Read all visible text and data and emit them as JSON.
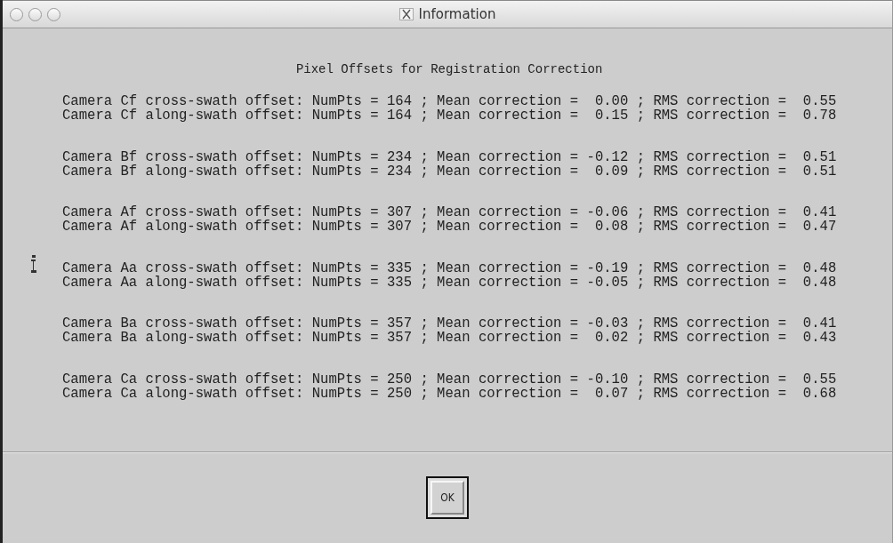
{
  "window": {
    "title": "Information"
  },
  "heading": "Pixel Offsets for Registration Correction",
  "groups": [
    {
      "lines": [
        "Camera Cf cross-swath offset: NumPts = 164 ; Mean correction =  0.00 ; RMS correction =  0.55",
        "Camera Cf along-swath offset: NumPts = 164 ; Mean correction =  0.15 ; RMS correction =  0.78"
      ]
    },
    {
      "lines": [
        "Camera Bf cross-swath offset: NumPts = 234 ; Mean correction = -0.12 ; RMS correction =  0.51",
        "Camera Bf along-swath offset: NumPts = 234 ; Mean correction =  0.09 ; RMS correction =  0.51"
      ]
    },
    {
      "lines": [
        "Camera Af cross-swath offset: NumPts = 307 ; Mean correction = -0.06 ; RMS correction =  0.41",
        "Camera Af along-swath offset: NumPts = 307 ; Mean correction =  0.08 ; RMS correction =  0.47"
      ]
    },
    {
      "lines": [
        "Camera Aa cross-swath offset: NumPts = 335 ; Mean correction = -0.19 ; RMS correction =  0.48",
        "Camera Aa along-swath offset: NumPts = 335 ; Mean correction = -0.05 ; RMS correction =  0.48"
      ]
    },
    {
      "lines": [
        "Camera Ba cross-swath offset: NumPts = 357 ; Mean correction = -0.03 ; RMS correction =  0.41",
        "Camera Ba along-swath offset: NumPts = 357 ; Mean correction =  0.02 ; RMS correction =  0.43"
      ]
    },
    {
      "lines": [
        "Camera Ca cross-swath offset: NumPts = 250 ; Mean correction = -0.10 ; RMS correction =  0.55",
        "Camera Ca along-swath offset: NumPts = 250 ; Mean correction =  0.07 ; RMS correction =  0.68"
      ]
    }
  ],
  "buttons": [
    "OK"
  ]
}
